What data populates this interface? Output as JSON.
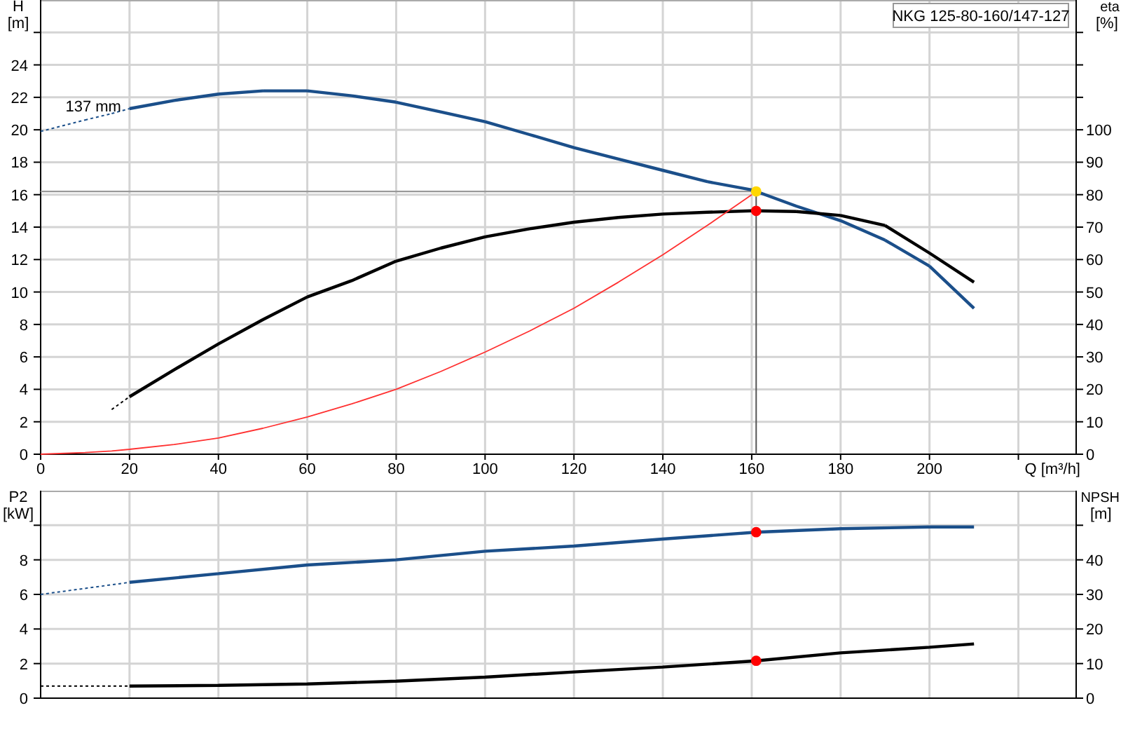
{
  "performance": {
    "title": "NKG 125-80-160/147-127",
    "left_axis": {
      "name": "H",
      "unit": "[m]"
    },
    "right_axis": {
      "name": "eta",
      "unit": "[%]"
    },
    "chart_data": {
      "type": "line",
      "grid": true,
      "xlabel": "Q [m³/h]",
      "xlim": [
        0,
        233
      ],
      "ylim": [
        0,
        28
      ],
      "y2lim": [
        0,
        140
      ],
      "xticks": [
        0,
        20,
        40,
        60,
        80,
        100,
        120,
        140,
        160,
        180,
        200
      ],
      "yticks": [
        0,
        2,
        4,
        6,
        8,
        10,
        12,
        14,
        16,
        18,
        20,
        22,
        24
      ],
      "y2ticks": [
        0,
        10,
        20,
        30,
        40,
        50,
        60,
        70,
        80,
        90,
        100
      ],
      "x": [
        0,
        10,
        16,
        20,
        30,
        40,
        50,
        60,
        70,
        80,
        90,
        100,
        110,
        120,
        130,
        140,
        150,
        160,
        161,
        170,
        180,
        190,
        200,
        210
      ],
      "series": [
        {
          "name": "137 mm",
          "color": "#1b4f8a",
          "values": [
            19.9,
            20.6,
            21.0,
            21.3,
            21.8,
            22.2,
            22.4,
            22.4,
            22.1,
            21.7,
            21.1,
            20.5,
            19.7,
            18.9,
            18.2,
            17.5,
            16.8,
            16.3,
            16.2,
            15.3,
            14.4,
            13.2,
            11.6,
            9.0
          ]
        },
        {
          "color": "#000000",
          "axis": "y2",
          "values": [
            null,
            null,
            13.8,
            17.7,
            26,
            34,
            41.5,
            48.5,
            53.5,
            59.5,
            63.5,
            67,
            69.5,
            71.5,
            73,
            74,
            74.6,
            75,
            75,
            74.8,
            73.6,
            70.5,
            62,
            53
          ]
        },
        {
          "color": "#ff3030",
          "values": [
            0,
            0.1,
            0.2,
            0.3,
            0.6,
            1.0,
            1.6,
            2.3,
            3.1,
            4.0,
            5.1,
            6.3,
            7.6,
            9.0,
            10.6,
            12.3,
            14.1,
            16.0,
            null,
            null,
            null,
            null,
            null,
            null
          ]
        },
        {
          "color": "#ffd700",
          "marker": "circle",
          "values": [
            null,
            null,
            null,
            null,
            null,
            null,
            null,
            null,
            null,
            null,
            null,
            null,
            null,
            null,
            null,
            null,
            null,
            null,
            16.2,
            null,
            null,
            null,
            null,
            null
          ]
        },
        {
          "color": "#ff0000",
          "marker": "circle",
          "axis": "y2",
          "values": [
            null,
            null,
            null,
            null,
            null,
            null,
            null,
            null,
            null,
            null,
            null,
            null,
            null,
            null,
            null,
            null,
            null,
            null,
            75,
            null,
            null,
            null,
            null,
            null
          ]
        }
      ],
      "ref_lines": [
        {
          "axis": "y",
          "value": 16.2
        },
        {
          "axis": "x",
          "value": 161
        }
      ]
    }
  },
  "power": {
    "left_axis": {
      "name": "P2",
      "unit": "[kW]"
    },
    "right_axis": {
      "name": "NPSH",
      "unit": "[m]"
    },
    "chart_data": {
      "type": "line",
      "grid": true,
      "xlim": [
        0,
        233
      ],
      "ylim": [
        0,
        12
      ],
      "y2lim": [
        0,
        60
      ],
      "yticks": [
        0,
        2,
        4,
        6,
        8
      ],
      "y2ticks": [
        0,
        10,
        20,
        30,
        40
      ],
      "x": [
        0,
        20,
        40,
        60,
        80,
        100,
        120,
        140,
        161,
        180,
        200,
        210
      ],
      "series": [
        {
          "color": "#1b4f8a",
          "values": [
            6.0,
            6.7,
            7.2,
            7.7,
            8.0,
            8.5,
            8.8,
            9.2,
            9.6,
            9.8,
            9.9,
            9.9
          ]
        },
        {
          "color": "#000000",
          "axis": "y2",
          "values": [
            3.5,
            3.5,
            3.7,
            4.1,
            4.9,
            6.1,
            7.6,
            9.0,
            10.8,
            13.1,
            14.7,
            15.7
          ]
        },
        {
          "color": "#ff0000",
          "marker": "circle",
          "values": [
            null,
            null,
            null,
            null,
            null,
            null,
            null,
            null,
            9.6,
            null,
            null,
            null
          ]
        },
        {
          "color": "#ff0000",
          "marker": "circle",
          "axis": "y2",
          "values": [
            null,
            null,
            null,
            null,
            null,
            null,
            null,
            null,
            10.8,
            null,
            null,
            null
          ]
        }
      ]
    }
  }
}
